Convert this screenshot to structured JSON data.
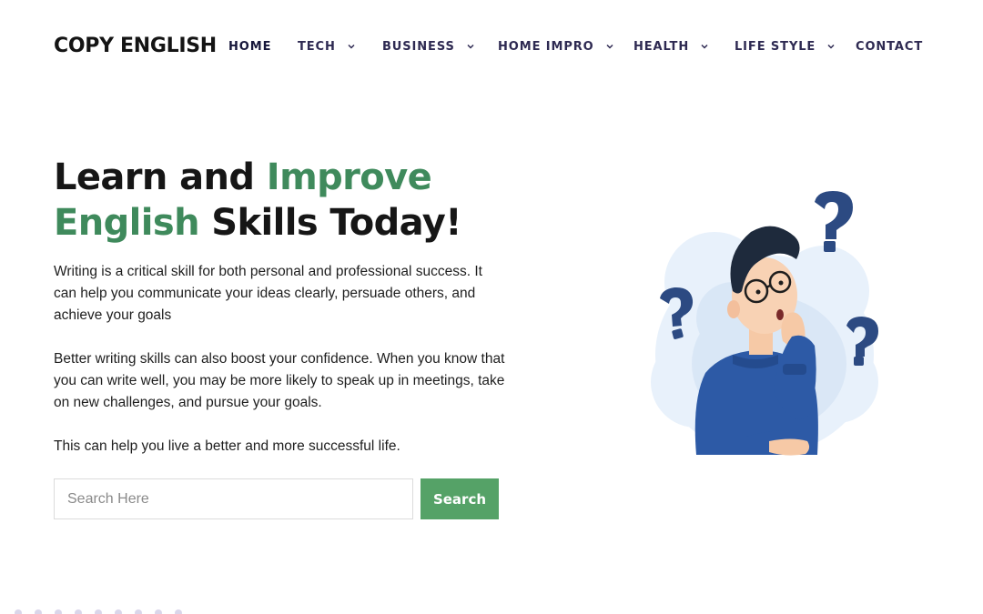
{
  "site": {
    "logo": "COPY ENGLISH"
  },
  "nav": {
    "home": "HOME",
    "tech": "TECH",
    "business": "BUSINESS",
    "home_impro": "HOME IMPRO",
    "health": "HEALTH",
    "life_style": "LIFE STYLE",
    "contact": "CONTACT"
  },
  "hero": {
    "title_part1": "Learn and ",
    "title_accent": "Improve English",
    "title_part2": " Skills Today!",
    "paragraph1": "Writing is a critical skill for both personal and professional success. It can help you communicate your ideas clearly, persuade others, and achieve your goals",
    "paragraph2": "Better writing skills can also boost your confidence. When you know that you can write well, you may be more likely to speak up in meetings, take on new challenges, and pursue your goals.",
    "paragraph3": "This can help you live a better and more successful life."
  },
  "search": {
    "placeholder": "Search Here",
    "value": "",
    "button_label": "Search"
  },
  "icons": {
    "dropdown": "chevron-down-icon",
    "illustration": "thinking-man-illustration",
    "question": "question-mark-icon"
  },
  "colors": {
    "accent_green": "#3f8a5c",
    "button_green": "#55a267",
    "nav_text": "#2e2a52",
    "heading": "#161616",
    "sweater_blue": "#2d5aa6",
    "question_mark": "#2c4a82"
  }
}
